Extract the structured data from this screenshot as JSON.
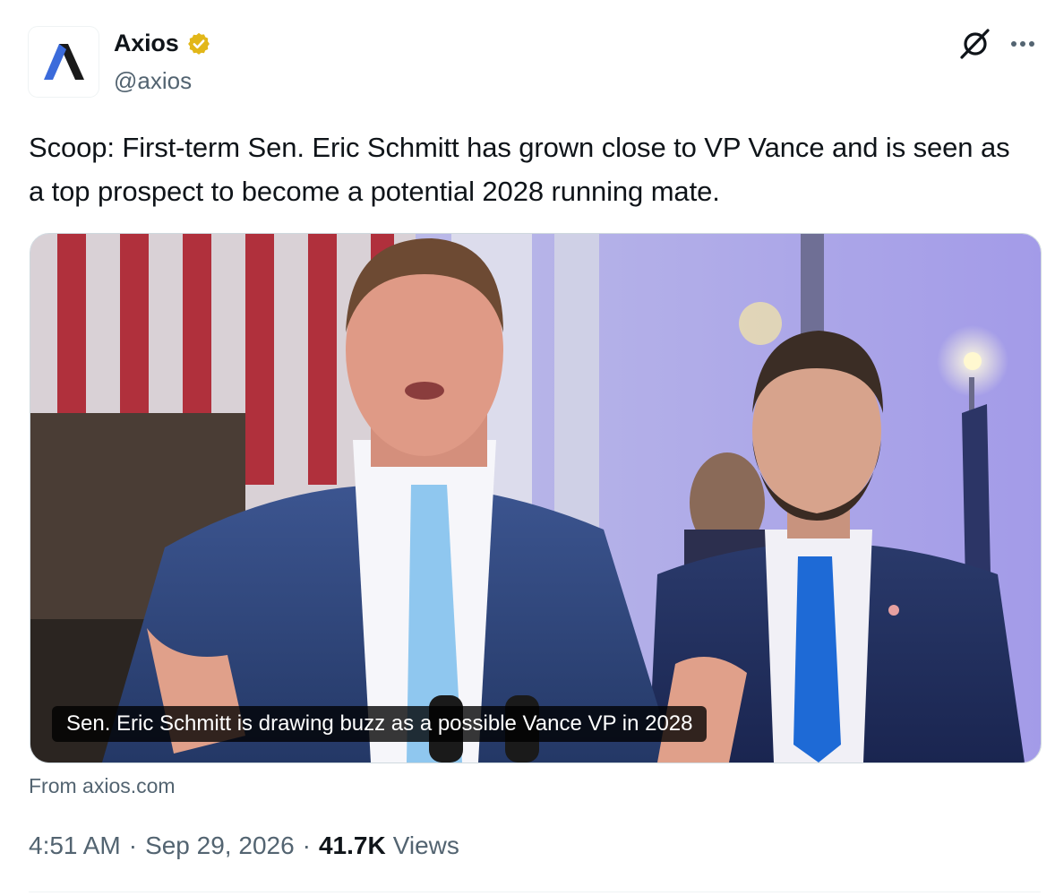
{
  "author": {
    "display_name": "Axios",
    "handle": "@axios",
    "verified": true,
    "verified_color": "#e2b719",
    "avatar_color": "#3b6bdb"
  },
  "icons": {
    "grok": "grok-icon",
    "more": "more-options-icon",
    "verified": "verified-badge-icon"
  },
  "tweet": {
    "text": "Scoop: First-term Sen. Eric Schmitt has grown close to VP Vance and is seen as a top prospect to become a potential 2028 running mate."
  },
  "card": {
    "caption": "Sen. Eric Schmitt is drawing buzz as a possible Vance VP in 2028",
    "source": "From axios.com"
  },
  "meta": {
    "time": "4:51 AM",
    "separator": "·",
    "date": "Sep 29, 2026",
    "views_count": "41.7K",
    "views_label": "Views"
  }
}
